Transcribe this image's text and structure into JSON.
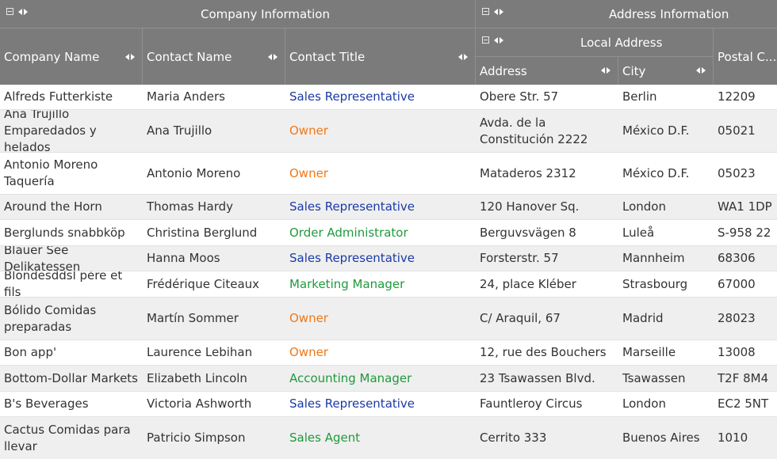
{
  "groups": {
    "company": {
      "title": "Company Information"
    },
    "address": {
      "title": "Address Information"
    },
    "local": {
      "title": "Local Address"
    }
  },
  "columns": {
    "company_name": "Company Name",
    "contact_name": "Contact Name",
    "contact_title": "Contact Title",
    "address": "Address",
    "city": "City",
    "postal_code": "Postal C..."
  },
  "title_colors": {
    "Sales Representative": "#1a3aa8",
    "Owner": "#f07818",
    "Order Administrator": "#1f9a3c",
    "Marketing Manager": "#1f9a3c",
    "Accounting Manager": "#1f9a3c",
    "Sales Agent": "#1f9a3c"
  },
  "rows": [
    {
      "company": "Alfreds Futterkiste",
      "contact": "Maria Anders",
      "title": "Sales Representative",
      "address": "Obere Str. 57",
      "city": "Berlin",
      "postal": "12209"
    },
    {
      "company": "Ana Trujillo Emparedados y helados",
      "contact": "Ana Trujillo",
      "title": "Owner",
      "address": "Avda. de la Constitución 2222",
      "city": "México D.F.",
      "postal": "05021"
    },
    {
      "company": "Antonio Moreno Taquería",
      "contact": "Antonio Moreno",
      "title": "Owner",
      "address": "Mataderos 2312",
      "city": "México D.F.",
      "postal": "05023"
    },
    {
      "company": "Around the Horn",
      "contact": "Thomas Hardy",
      "title": "Sales Representative",
      "address": "120 Hanover Sq.",
      "city": "London",
      "postal": "WA1 1DP"
    },
    {
      "company": "Berglunds snabbköp",
      "contact": "Christina Berglund",
      "title": "Order Administrator",
      "address": "Berguvsvägen 8",
      "city": "Luleå",
      "postal": "S-958 22"
    },
    {
      "company": "Blauer See Delikatessen",
      "contact": "Hanna Moos",
      "title": "Sales Representative",
      "address": "Forsterstr. 57",
      "city": "Mannheim",
      "postal": "68306"
    },
    {
      "company": "Blondesddsl père et fils",
      "contact": "Frédérique Citeaux",
      "title": "Marketing Manager",
      "address": "24, place Kléber",
      "city": "Strasbourg",
      "postal": "67000"
    },
    {
      "company": "Bólido Comidas preparadas",
      "contact": "Martín Sommer",
      "title": "Owner",
      "address": "C/ Araquil, 67",
      "city": "Madrid",
      "postal": "28023"
    },
    {
      "company": "Bon app'",
      "contact": "Laurence Lebihan",
      "title": "Owner",
      "address": "12, rue des Bouchers",
      "city": "Marseille",
      "postal": "13008"
    },
    {
      "company": "Bottom-Dollar Markets",
      "contact": "Elizabeth Lincoln",
      "title": "Accounting Manager",
      "address": "23 Tsawassen Blvd.",
      "city": "Tsawassen",
      "postal": "T2F 8M4"
    },
    {
      "company": "B's Beverages",
      "contact": "Victoria Ashworth",
      "title": "Sales Representative",
      "address": "Fauntleroy Circus",
      "city": "London",
      "postal": "EC2 5NT"
    },
    {
      "company": "Cactus Comidas para llevar",
      "contact": "Patricio Simpson",
      "title": "Sales Agent",
      "address": "Cerrito 333",
      "city": "Buenos Aires",
      "postal": "1010"
    }
  ]
}
